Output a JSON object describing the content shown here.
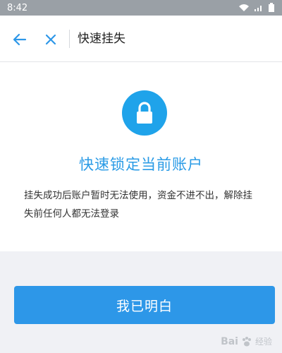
{
  "status_bar": {
    "time": "8:42"
  },
  "nav": {
    "title": "快速挂失"
  },
  "content": {
    "heading": "快速锁定当前账户",
    "description": "挂失成功后账户暂时无法使用，资金不进不出，解除挂失前任何人都无法登录"
  },
  "actions": {
    "confirm_label": "我已明白"
  },
  "watermark": {
    "brand": "Bai",
    "suffix": "经验"
  },
  "colors": {
    "accent": "#2d97e8",
    "heading": "#2a9be6",
    "lock_bg": "#1fa3ea",
    "status_bar": "#9aa0a6"
  },
  "icons": {
    "back": "arrow-left-icon",
    "close": "close-icon",
    "lock": "lock-icon",
    "wifi": "wifi-icon",
    "signal": "signal-icon",
    "battery": "battery-icon"
  }
}
